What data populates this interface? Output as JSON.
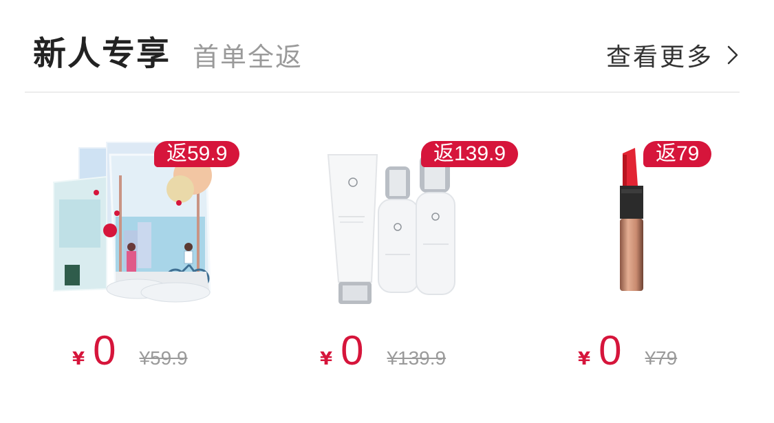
{
  "header": {
    "title": "新人专享",
    "subtitle": "首单全返",
    "more_label": "查看更多"
  },
  "colors": {
    "accent": "#d6153b",
    "title": "#222222",
    "muted": "#9a9a9a"
  },
  "products": [
    {
      "rebate": "返59.9",
      "currency": "¥",
      "price": "0",
      "original_price": "¥59.9",
      "image": "face-mask-set-image"
    },
    {
      "rebate": "返139.9",
      "currency": "¥",
      "price": "0",
      "original_price": "¥139.9",
      "image": "skincare-bottles-image"
    },
    {
      "rebate": "返79",
      "currency": "¥",
      "price": "0",
      "original_price": "¥79",
      "image": "lipstick-image"
    }
  ]
}
